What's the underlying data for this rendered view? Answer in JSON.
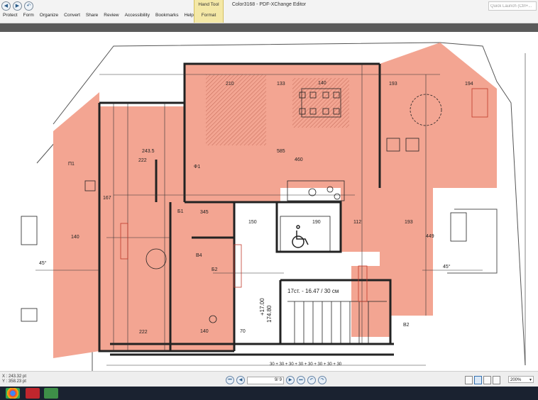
{
  "window": {
    "title": "Color3168 - PDF-XChange Editor"
  },
  "quick_access": {
    "icons": [
      "back-icon",
      "forward-icon",
      "undo-icon"
    ]
  },
  "search": {
    "placeholder": "Quick Launch (Ctrl+..."
  },
  "menu": {
    "items": [
      "Protect",
      "Form",
      "Organize",
      "Convert",
      "Share",
      "Review",
      "Accessibility",
      "Bookmarks",
      "Help"
    ]
  },
  "context_tab": {
    "group": "Hand Tool",
    "tab": "Format"
  },
  "plan": {
    "labels": {
      "room_numbers": [
        "210",
        "133",
        "140",
        "193",
        "194",
        "243.5",
        "585",
        "460",
        "222",
        "167",
        "193",
        "449",
        "140",
        "222",
        "112",
        "190",
        "150",
        "345",
        "140",
        "70"
      ],
      "stair": "17ст. - 16.47 / 30 см",
      "level": "+17.00",
      "level2": "174.80",
      "angle": "45°",
      "stairs_sequence": "30 + 30 + 30 + 30 + 30 + 30 + 30 + 30",
      "openings": [
        "П1",
        "Ф1",
        "Б1",
        "В4",
        "Б2",
        "В2"
      ]
    },
    "colors": {
      "fill": "#f3a592",
      "wall": "#222222",
      "hatch": "#c87060"
    }
  },
  "status": {
    "x_label": "X : 243.32 pt",
    "y_label": "Y : 358.23 pt",
    "page": "9",
    "page_total": "/ 9",
    "zoom": "200%"
  },
  "taskbar": {
    "apps": [
      "chrome-icon",
      "acrobat-icon",
      "xchange-icon"
    ]
  }
}
